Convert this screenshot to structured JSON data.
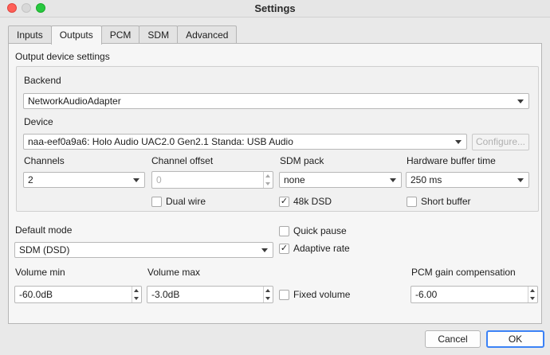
{
  "window": {
    "title": "Settings"
  },
  "tabs": [
    {
      "label": "Inputs",
      "active": false
    },
    {
      "label": "Outputs",
      "active": true
    },
    {
      "label": "PCM",
      "active": false
    },
    {
      "label": "SDM",
      "active": false
    },
    {
      "label": "Advanced",
      "active": false
    }
  ],
  "section_title": "Output device settings",
  "backend": {
    "label": "Backend",
    "value": "NetworkAudioAdapter"
  },
  "device": {
    "label": "Device",
    "value": "naa-eef0a9a6: Holo Audio UAC2.0 Gen2.1 Standa: USB Audio",
    "configure_label": "Configure..."
  },
  "channels": {
    "label": "Channels",
    "value": "2"
  },
  "channel_offset": {
    "label": "Channel offset",
    "value": "0"
  },
  "sdm_pack": {
    "label": "SDM pack",
    "value": "none"
  },
  "hardware_buffer": {
    "label": "Hardware buffer time",
    "value": "250 ms"
  },
  "dual_wire": {
    "label": "Dual wire",
    "checked": false
  },
  "dsd48k": {
    "label": "48k DSD",
    "checked": true,
    "mark": "✓"
  },
  "short_buffer": {
    "label": "Short buffer",
    "checked": false
  },
  "default_mode": {
    "label": "Default mode",
    "value": "SDM (DSD)"
  },
  "quick_pause": {
    "label": "Quick pause",
    "checked": false
  },
  "adaptive_rate": {
    "label": "Adaptive rate",
    "checked": true,
    "mark": "✓"
  },
  "volume_min": {
    "label": "Volume min",
    "value": "-60.0dB"
  },
  "volume_max": {
    "label": "Volume max",
    "value": "-3.0dB"
  },
  "fixed_volume": {
    "label": "Fixed volume",
    "checked": false
  },
  "pcm_gain": {
    "label": "PCM gain compensation",
    "value": "-6.00"
  },
  "buttons": {
    "cancel": "Cancel",
    "ok": "OK"
  }
}
